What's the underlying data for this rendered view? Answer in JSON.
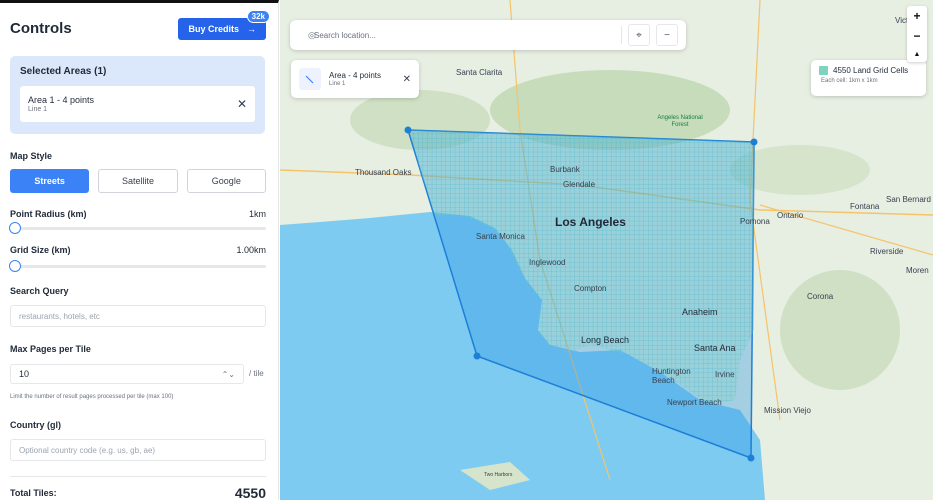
{
  "sidebar": {
    "title": "Controls",
    "buy_credits_label": "Buy Credits",
    "buy_credits_arrow": "→",
    "credits_badge": "32k",
    "selected_areas_title": "Selected Areas (1)",
    "selected_areas": [
      {
        "name": "Area 1 - 4 points",
        "subtitle": "Line 1"
      }
    ],
    "map_style_label": "Map Style",
    "map_styles": [
      "Streets",
      "Satellite",
      "Google"
    ],
    "active_style": "Streets",
    "point_radius_label": "Point Radius (km)",
    "point_radius_value": "1km",
    "point_radius_fraction": 0,
    "grid_size_label": "Grid Size (km)",
    "grid_size_value": "1.00km",
    "grid_size_fraction": 0,
    "search_query_label": "Search Query",
    "search_query_placeholder": "restaurants, hotels, etc",
    "max_pages_label": "Max Pages per Tile",
    "max_pages_value": "10",
    "max_pages_unit": "/ tile",
    "max_pages_hint": "Limit the number of result pages processed per tile (max 100)",
    "country_label": "Country (gl)",
    "country_placeholder": "Optional country code (e.g. us, gb, ae)",
    "total_tiles_label": "Total Tiles:",
    "total_tiles_value": "4550"
  },
  "map": {
    "search_placeholder": "Search location...",
    "area_chip": {
      "name": "Area - 4 points",
      "subtitle": "Line 1"
    },
    "legend": {
      "title": "4550 Land Grid Cells",
      "subtitle": "Each cell: 1km x 1km"
    },
    "zoom_in": "+",
    "zoom_out": "−",
    "compass": "▲",
    "place_labels": {
      "los_angeles": "Los Angeles",
      "burbank": "Burbank",
      "glendale": "Glendale",
      "santa_monica": "Santa Monica",
      "inglewood": "Inglewood",
      "compton": "Compton",
      "long_beach": "Long Beach",
      "anaheim": "Anaheim",
      "santa_ana": "Santa Ana",
      "huntington_beach": "Huntington Beach",
      "irvine": "Irvine",
      "newport_beach": "Newport Beach",
      "thousand_oaks": "Thousand Oaks",
      "santa_clarita": "Santa Clarita",
      "pomona": "Pomona",
      "ontario": "Ontario",
      "fontana": "Fontana",
      "san_bernardino": "San Bernard",
      "riverside": "Riverside",
      "moreno": "Moren",
      "corona": "Corona",
      "mission_viejo": "Mission Viejo",
      "angeles_forest": "Angeles National Forest",
      "two_harbors": "Two Harbors",
      "victorville": "Victi"
    },
    "colors": {
      "water": "#7ecbf2",
      "land": "#e7eee2",
      "grid": "#22a7d8",
      "polygon": "#1d7fd6",
      "accent": "#3b82f6"
    }
  }
}
